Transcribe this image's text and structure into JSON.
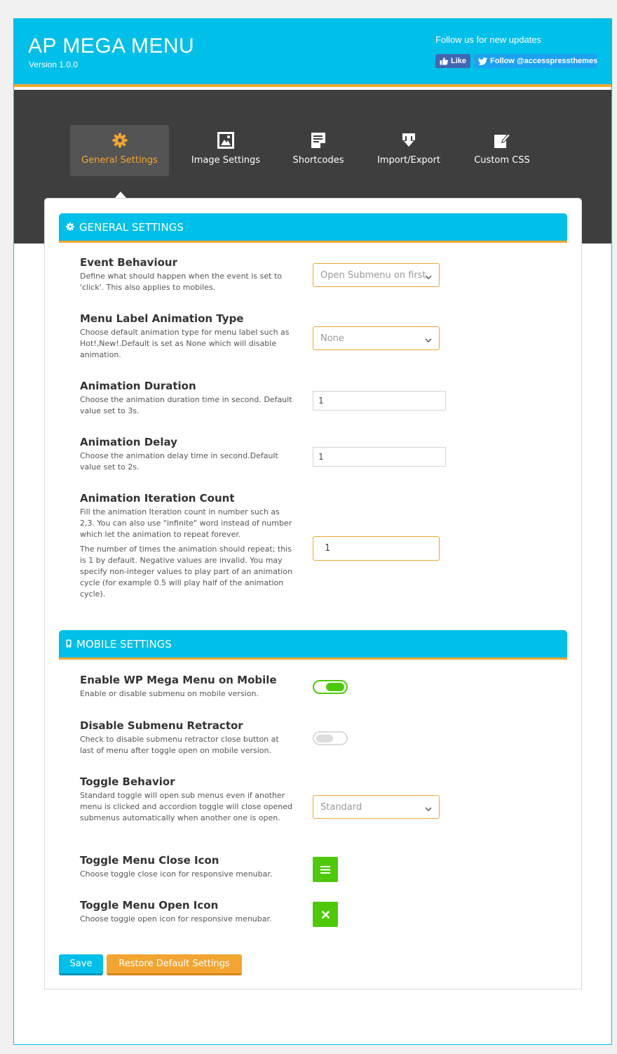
{
  "header": {
    "title": "AP MEGA MENU",
    "version": "Version 1.0.0",
    "follow_text": "Follow us for new updates",
    "facebook_label": "Like",
    "twitter_label": "Follow @accesspressthemes"
  },
  "tabs": [
    {
      "label": "General Settings",
      "icon": "gear-icon",
      "active": true
    },
    {
      "label": "Image Settings",
      "icon": "image-icon",
      "active": false
    },
    {
      "label": "Shortcodes",
      "icon": "document-icon",
      "active": false
    },
    {
      "label": "Import/Export",
      "icon": "download-icon",
      "active": false
    },
    {
      "label": "Custom CSS",
      "icon": "edit-icon",
      "active": false
    }
  ],
  "general": {
    "heading": "GENERAL SETTINGS",
    "event_behaviour": {
      "title": "Event Behaviour",
      "desc": "Define what should happen when the event is set to 'click'. This also applies to mobiles.",
      "value": "Open Submenu on first"
    },
    "label_animation": {
      "title": "Menu Label Animation Type",
      "desc": "Choose default animation type for menu label such as Hot!,New!.Default is set as None which will disable animation.",
      "value": "None"
    },
    "animation_duration": {
      "title": "Animation Duration",
      "desc": "Choose the animation duration time in second. Default value set to 3s.",
      "value": "1"
    },
    "animation_delay": {
      "title": "Animation Delay",
      "desc": "Choose the animation delay time in second.Default value set to 2s.",
      "value": "1"
    },
    "iteration_count": {
      "title": "Animation Iteration Count",
      "desc": "Fill the animation Iteration count in number such as 2,3. You can also use \"infinite\" word instead of number which let the animation to repeat forever.",
      "desc2": "The number of times the animation should repeat; this is 1 by default. Negative values are invalid. You may specify non-integer values to play part of an animation cycle (for example 0.5 will play half of the animation cycle).",
      "value": "1"
    }
  },
  "mobile": {
    "heading": "MOBILE SETTINGS",
    "enable_mobile": {
      "title": "Enable WP Mega Menu on Mobile",
      "desc": "Enable or disable submenu on mobile version.",
      "enabled": true
    },
    "disable_retractor": {
      "title": "Disable Submenu Retractor",
      "desc": "Check to disable submenu retractor close button at last of menu after toggle open on mobile version.",
      "enabled": false
    },
    "toggle_behavior": {
      "title": "Toggle Behavior",
      "desc": "Standard toggle will open sub menus even if another menu is clicked and accordion toggle will close opened submenus automatically when another one is open.",
      "value": "Standard"
    },
    "close_icon": {
      "title": "Toggle Menu Close Icon",
      "desc": "Choose toggle close icon for responsive menubar.",
      "icon": "hamburger-icon"
    },
    "open_icon": {
      "title": "Toggle Menu Open Icon",
      "desc": "Choose toggle open icon for responsive menubar.",
      "icon": "close-icon"
    }
  },
  "actions": {
    "save_label": "Save",
    "restore_label": "Restore Default Settings"
  },
  "colors": {
    "primary": "#00bfe8",
    "accent": "#f2a531",
    "dark": "#3e3e3e",
    "toggle_on": "#4ec90a"
  }
}
